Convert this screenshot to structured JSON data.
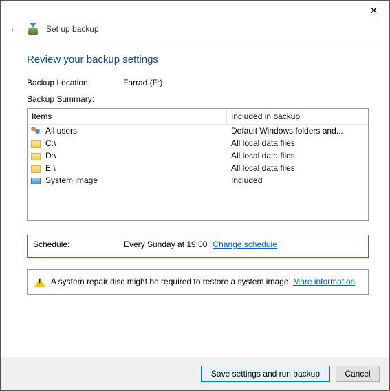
{
  "window": {
    "title": "Set up backup",
    "close_glyph": "✕",
    "back_glyph": "←"
  },
  "page": {
    "heading": "Review your backup settings",
    "location_label": "Backup Location:",
    "location_value": "Farrad (F:)",
    "summary_label": "Backup Summary:",
    "columns": {
      "items": "Items",
      "included": "Included in backup"
    },
    "rows": [
      {
        "icon": "users",
        "item": "All users",
        "included": "Default Windows folders and..."
      },
      {
        "icon": "folder",
        "item": "C:\\",
        "included": "All local data files"
      },
      {
        "icon": "folder",
        "item": "D:\\",
        "included": "All local data files"
      },
      {
        "icon": "folder",
        "item": "E:\\",
        "included": "All local data files"
      },
      {
        "icon": "monitor",
        "item": "System image",
        "included": "Included"
      }
    ],
    "schedule_label": "Schedule:",
    "schedule_value": "Every Sunday at 19:00",
    "schedule_link": "Change schedule",
    "info_text": "A system repair disc might be required to restore a system image. ",
    "info_link": "More information"
  },
  "footer": {
    "primary": "Save settings and run backup",
    "cancel": "Cancel"
  }
}
